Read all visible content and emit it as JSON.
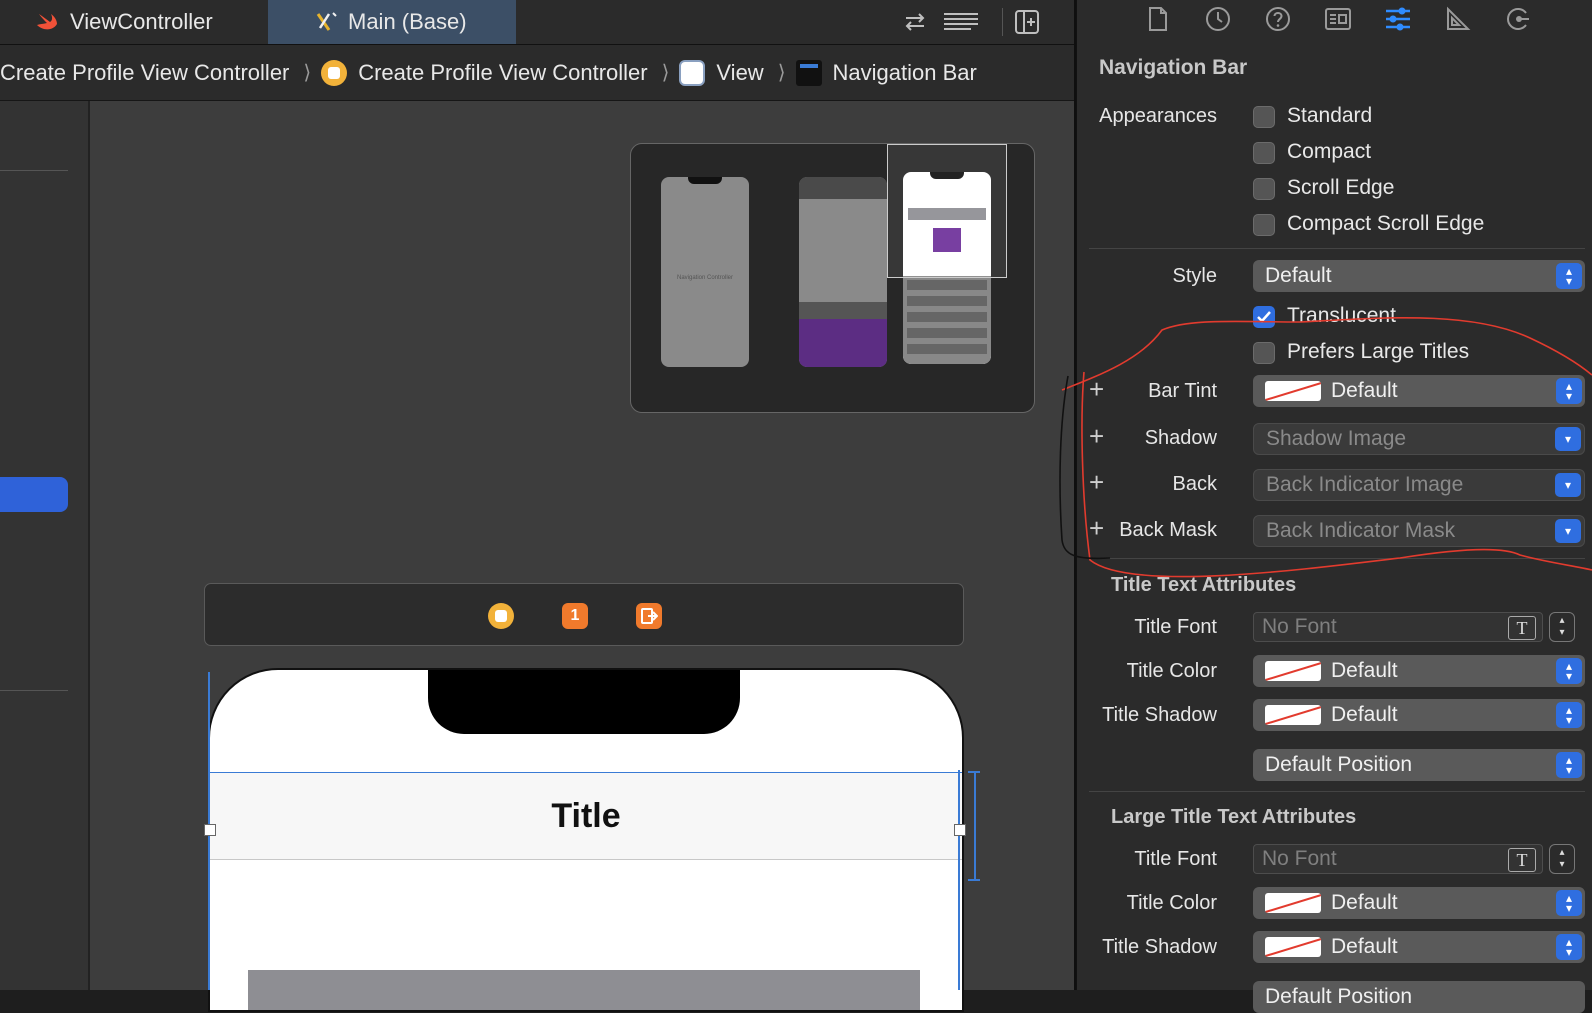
{
  "tabs": {
    "file": "ViewController",
    "storyboard": "Main (Base)"
  },
  "breadcrumb": [
    "Create Profile View Controller",
    "Create Profile View Controller",
    "View",
    "Navigation Bar"
  ],
  "canvas": {
    "minimap_phone_label": "Navigation Controller",
    "badge_count": "1",
    "nav_title": "Title"
  },
  "inspector": {
    "section_title": "Navigation Bar",
    "appearances_label": "Appearances",
    "appearances": [
      "Standard",
      "Compact",
      "Scroll Edge",
      "Compact Scroll Edge"
    ],
    "style_label": "Style",
    "style_value": "Default",
    "translucent_label": "Translucent",
    "translucent_checked": true,
    "prefers_large_label": "Prefers Large Titles",
    "bar_tint_label": "Bar Tint",
    "bar_tint_value": "Default",
    "shadow_label": "Shadow",
    "shadow_placeholder": "Shadow Image",
    "back_label": "Back",
    "back_placeholder": "Back Indicator Image",
    "back_mask_label": "Back Mask",
    "back_mask_placeholder": "Back Indicator Mask",
    "title_text_section": "Title Text Attributes",
    "title_font_label": "Title Font",
    "title_font_value": "No Font",
    "title_color_label": "Title Color",
    "title_color_value": "Default",
    "title_shadow_label": "Title Shadow",
    "title_shadow_value": "Default",
    "position_value": "Default Position",
    "large_title_section": "Large Title Text Attributes",
    "large_title_font_label": "Title Font",
    "large_title_font_value": "No Font",
    "large_title_color_label": "Title Color",
    "large_title_color_value": "Default",
    "large_title_shadow_label": "Title Shadow",
    "large_title_shadow_value": "Default",
    "large_position_value": "Default Position"
  },
  "colors": {
    "accent": "#2f6ee0",
    "annotation": "#e23b2e",
    "selection": "#3a7bd5"
  }
}
